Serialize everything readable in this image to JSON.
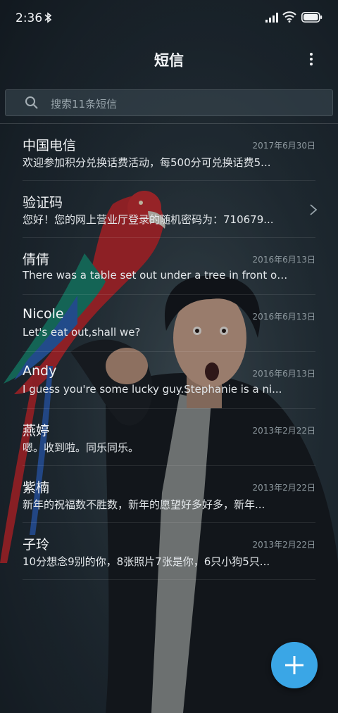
{
  "status_bar": {
    "time": "2:36",
    "icons": [
      "bluetooth-icon",
      "cellular-signal-icon",
      "wifi-icon",
      "battery-icon"
    ]
  },
  "app_bar": {
    "title": "短信",
    "menu_icon": "more-vertical-icon"
  },
  "search": {
    "icon": "search-icon",
    "placeholder": "搜索11条短信"
  },
  "conversations": [
    {
      "name": "中国电信",
      "date": "2017年6月30日",
      "preview": "欢迎参加积分兑换话费活动，每500分可兑换话费5..."
    },
    {
      "name": "验证码",
      "date": "",
      "preview": "您好！您的网上营业厅登录的随机密码为：710679...",
      "icon": "chevron-right-icon"
    },
    {
      "name": "倩倩",
      "date": "2016年6月13日",
      "preview": "There was a table set out under a tree in front of ..."
    },
    {
      "name": "Nicole",
      "date": "2016年6月13日",
      "preview": "Let's eat out,shall we?"
    },
    {
      "name": "Andy",
      "date": "2016年6月13日",
      "preview": "I guess you're some lucky guy.Stephanie is a ni..."
    },
    {
      "name": "燕婷",
      "date": "2013年2月22日",
      "preview": "嗯。收到啦。同乐同乐。"
    },
    {
      "name": "紫楠",
      "date": "2013年2月22日",
      "preview": "新年的祝福数不胜数，新年的愿望好多好多，新年..."
    },
    {
      "name": "子玲",
      "date": "2013年2月22日",
      "preview": "10分想念9别的你，8张照片7张是你，6只小狗5只..."
    }
  ],
  "fab": {
    "icon": "plus-icon",
    "color": "#3aa6e6"
  },
  "colors": {
    "background": "#25323a",
    "accent": "#3aa6e6"
  }
}
